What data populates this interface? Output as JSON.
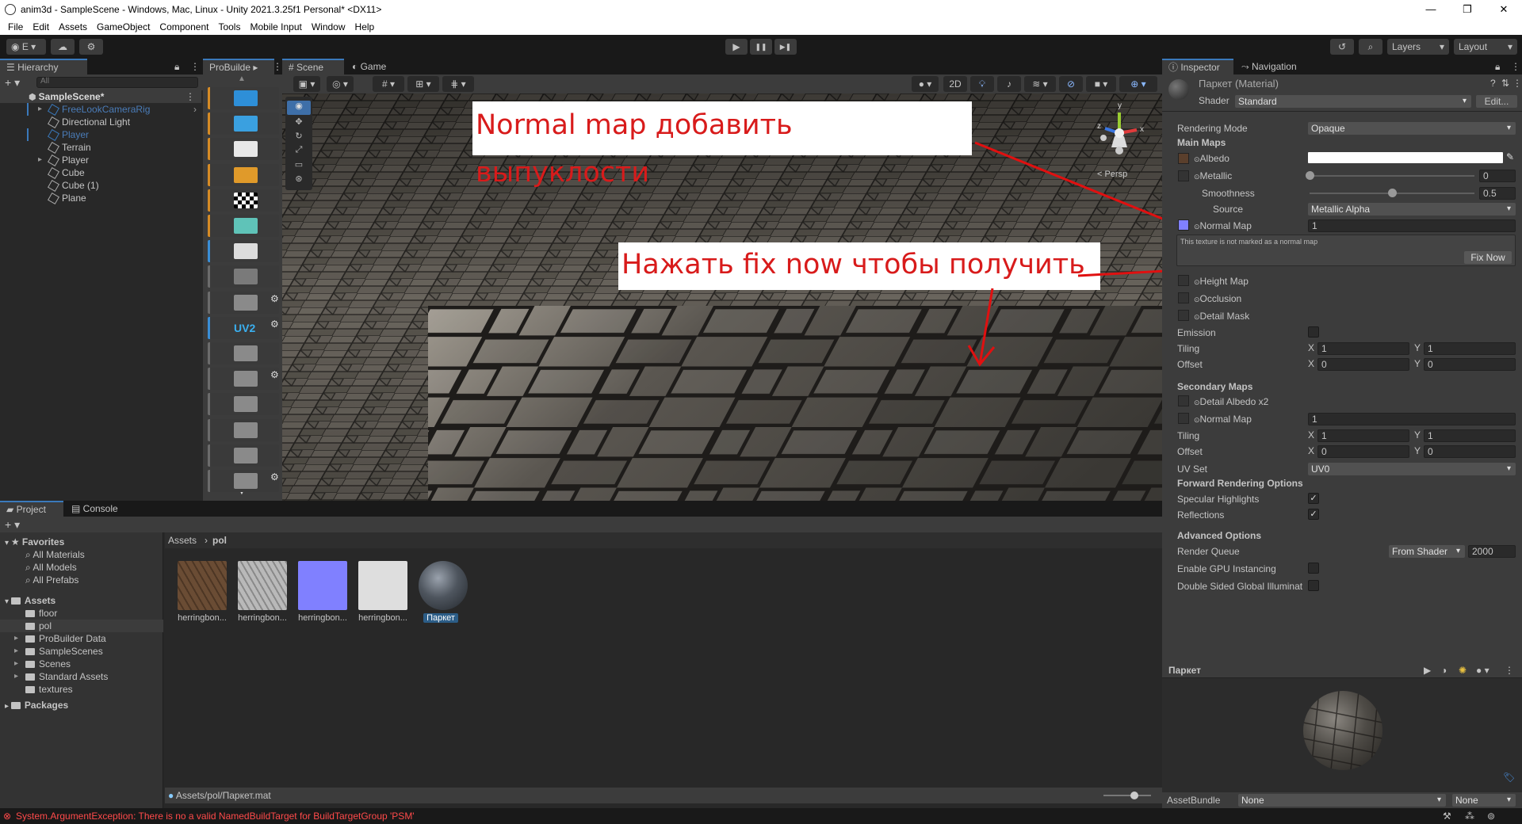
{
  "window": {
    "title": "anim3d - SampleScene - Windows, Mac, Linux - Unity 2021.3.25f1 Personal* <DX11>",
    "controls": [
      "—",
      "❐",
      "✕"
    ]
  },
  "menu": [
    "File",
    "Edit",
    "Assets",
    "GameObject",
    "Component",
    "Tools",
    "Mobile Input",
    "Window",
    "Help"
  ],
  "toolbar": {
    "account_label": "E",
    "play": "▶",
    "pause": "❚❚",
    "step": "▶❚",
    "layers": "Layers",
    "layout": "Layout"
  },
  "hierarchy": {
    "tab": "Hierarchy",
    "search_placeholder": "All",
    "scene": "SampleScene*",
    "items": [
      {
        "label": "FreeLookCameraRig",
        "state": "inactive-prefab",
        "expandable": true
      },
      {
        "label": "Directional Light",
        "state": "normal",
        "expandable": false
      },
      {
        "label": "Player",
        "state": "inactive-prefab",
        "expandable": false
      },
      {
        "label": "Terrain",
        "state": "normal",
        "expandable": false
      },
      {
        "label": "Player",
        "state": "normal",
        "expandable": true
      },
      {
        "label": "Cube",
        "state": "normal",
        "expandable": false
      },
      {
        "label": "Cube (1)",
        "state": "normal",
        "expandable": false
      },
      {
        "label": "Plane",
        "state": "normal",
        "expandable": false
      }
    ]
  },
  "probuilder": {
    "tab": "ProBuilde",
    "uv2_label": "UV2"
  },
  "scene_view": {
    "tabs": [
      "Scene",
      "Game"
    ],
    "mode_2d": "2D",
    "persp": "< Persp",
    "axes": {
      "x": "x",
      "y": "y",
      "z": "z"
    }
  },
  "annotations": {
    "top": "Normal map добавить выпуклости",
    "middle": "Нажать fix now чтобы получить"
  },
  "inspector": {
    "tabs": [
      "Inspector",
      "Navigation"
    ],
    "material_name": "Паркет (Material)",
    "shader_label": "Shader",
    "shader_value": "Standard",
    "edit_button": "Edit...",
    "rendering_mode_label": "Rendering Mode",
    "rendering_mode_value": "Opaque",
    "main_maps": "Main Maps",
    "albedo": "Albedo",
    "metallic": "Metallic",
    "metallic_value": "0",
    "metallic_slider": 0.0,
    "smoothness": "Smoothness",
    "smoothness_value": "0.5",
    "smoothness_slider": 0.5,
    "source": "Source",
    "source_value": "Metallic Alpha",
    "normal_map": "Normal Map",
    "normal_map_value": "1",
    "warning": "This texture is not marked as a normal map",
    "fix_now": "Fix Now",
    "height_map": "Height Map",
    "occlusion": "Occlusion",
    "detail_mask": "Detail Mask",
    "emission": "Emission",
    "tiling": "Tiling",
    "offset": "Offset",
    "x": "X",
    "y": "Y",
    "tiling_x": "1",
    "tiling_y": "1",
    "offset_x": "0",
    "offset_y": "0",
    "secondary_maps": "Secondary Maps",
    "detail_albedo": "Detail Albedo x2",
    "normal_map2": "Normal Map",
    "normal_map2_value": "1",
    "tiling2_x": "1",
    "tiling2_y": "1",
    "offset2_x": "0",
    "offset2_y": "0",
    "uv_set": "UV Set",
    "uv_set_value": "UV0",
    "forward_options": "Forward Rendering Options",
    "specular_highlights": "Specular Highlights",
    "reflections": "Reflections",
    "advanced": "Advanced Options",
    "render_queue": "Render Queue",
    "render_queue_mode": "From Shader",
    "render_queue_value": "2000",
    "gpu_instancing": "Enable GPU Instancing",
    "double_sided": "Double Sided Global Illuminat",
    "preview_title": "Паркет",
    "assetbundle_label": "AssetBundle",
    "assetbundle_value": "None",
    "assetbundle_variant": "None",
    "colors": {
      "albedo": "#5a3f2c",
      "normal_map": "#8080ff"
    }
  },
  "project": {
    "tabs": [
      "Project",
      "Console"
    ],
    "favorites": "Favorites",
    "favorite_items": [
      "All Materials",
      "All Models",
      "All Prefabs"
    ],
    "assets": "Assets",
    "asset_folders": [
      "floor",
      "pol",
      "ProBuilder Data",
      "SampleScenes",
      "Scenes",
      "Standard Assets",
      "textures"
    ],
    "packages": "Packages",
    "breadcrumb": [
      "Assets",
      "pol"
    ],
    "files": [
      {
        "label": "herringbon...",
        "kind": "albedo"
      },
      {
        "label": "herringbon...",
        "kind": "height"
      },
      {
        "label": "herringbon...",
        "kind": "normal"
      },
      {
        "label": "herringbon...",
        "kind": "white"
      },
      {
        "label": "Паркет",
        "kind": "material",
        "selected": true
      }
    ],
    "path": "Assets/pol/Паркет.mat"
  },
  "status": {
    "error": "System.ArgumentException: There is no a valid NamedBuildTarget for BuildTargetGroup 'PSM'"
  }
}
